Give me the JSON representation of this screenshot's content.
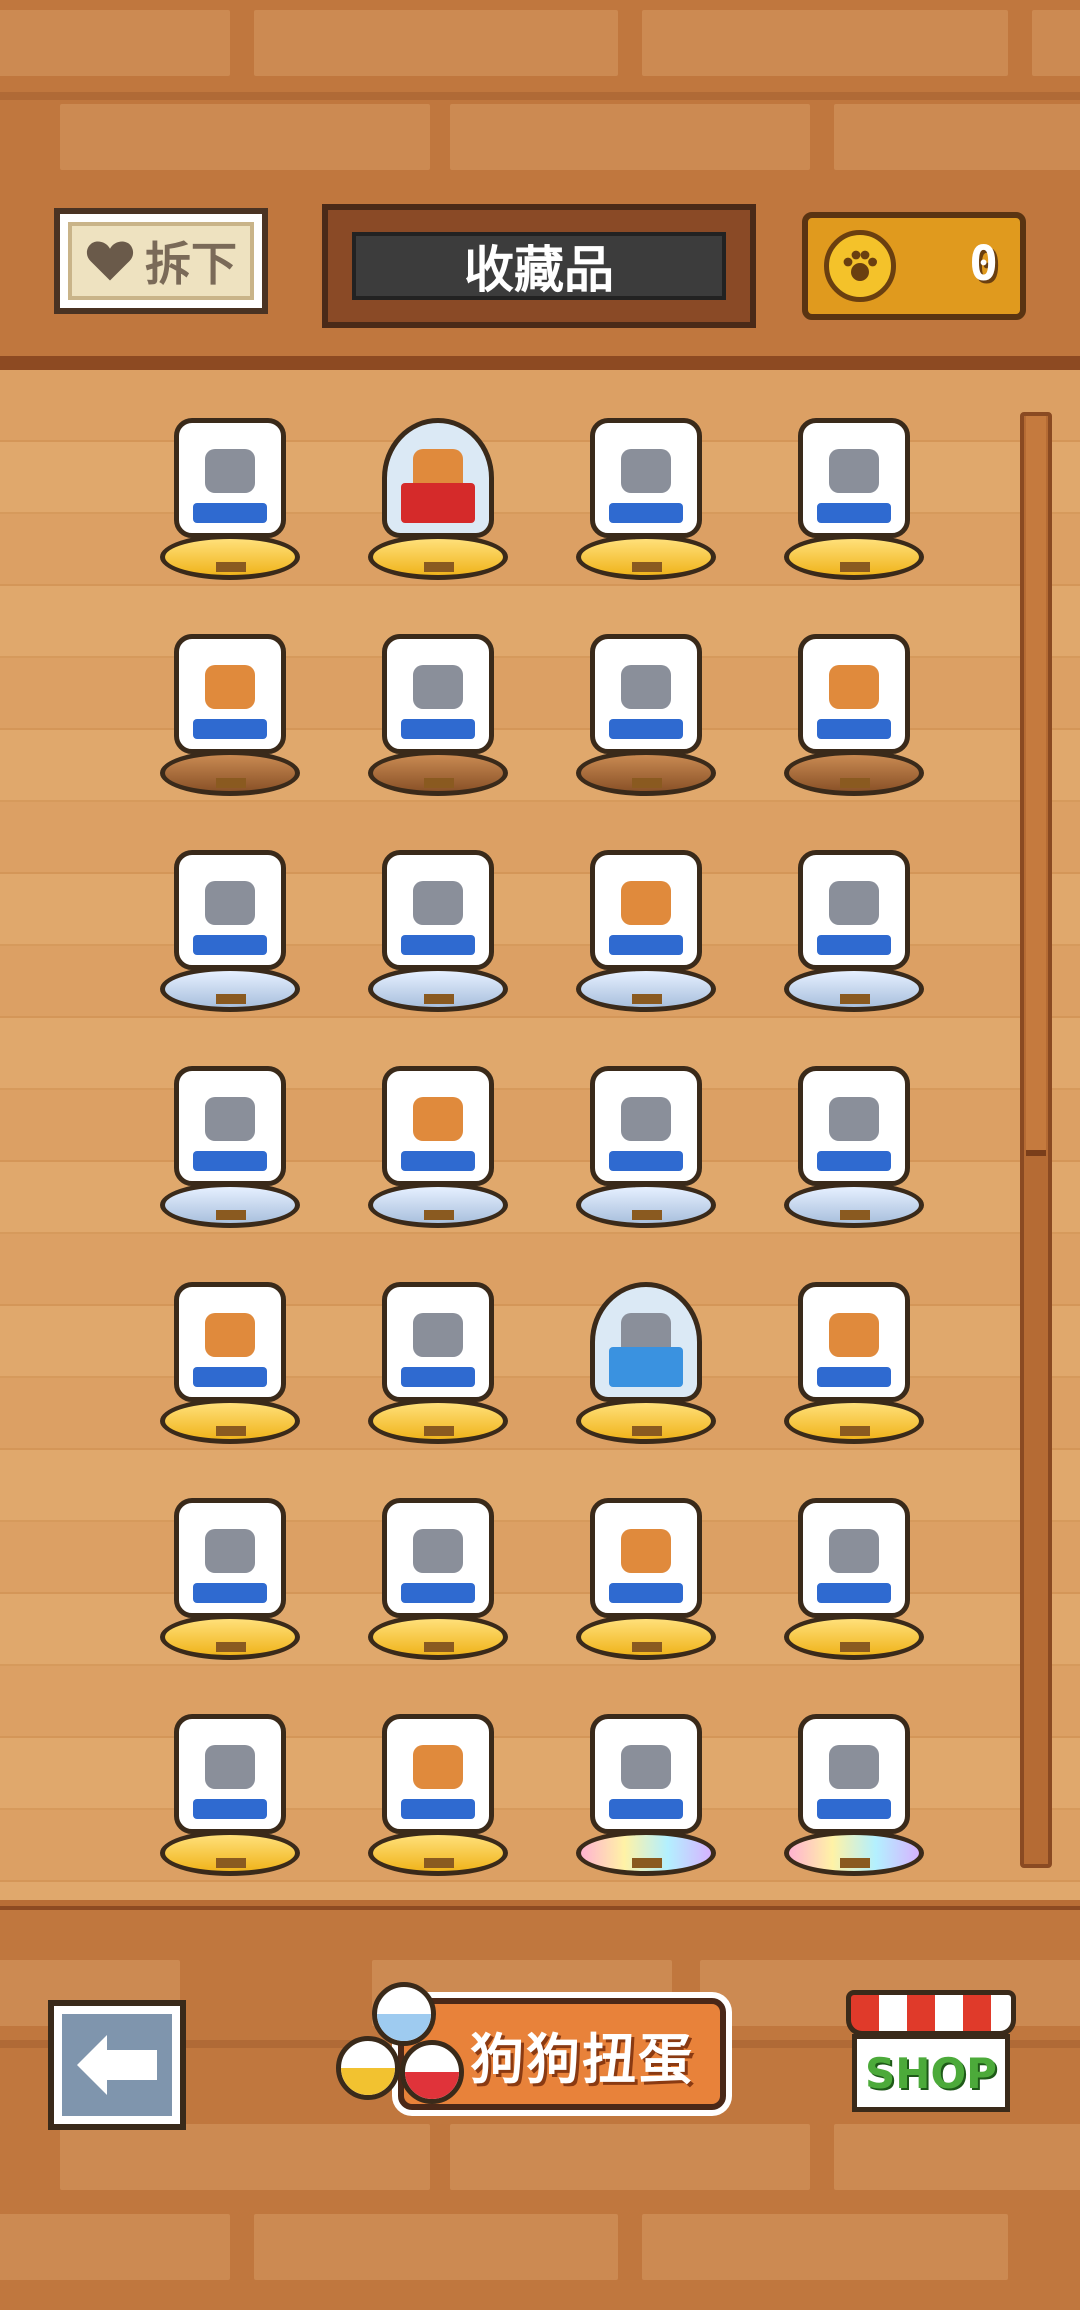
{
  "header": {
    "unequip_label": "拆下",
    "title": "收藏品",
    "coins": "0"
  },
  "collection": {
    "rows": [
      [
        "gold",
        "gold",
        "gold",
        "gold"
      ],
      [
        "wood",
        "wood",
        "wood",
        "wood"
      ],
      [
        "silver",
        "silver",
        "silver",
        "silver"
      ],
      [
        "silver",
        "silver",
        "silver",
        "silver"
      ],
      [
        "gold",
        "gold",
        "gold",
        "gold"
      ],
      [
        "gold",
        "gold",
        "gold",
        "gold"
      ],
      [
        "gold",
        "gold",
        "rainbow",
        "rainbow"
      ]
    ]
  },
  "bottom_bar": {
    "gacha_label": "狗狗扭蛋",
    "shop_label": "SHOP"
  },
  "colors": {
    "brick": "#c0773e",
    "shelf": "#dca064",
    "coin": "#e09a1e",
    "gacha": "#e8823a",
    "shop_green": "#4caa3a"
  }
}
